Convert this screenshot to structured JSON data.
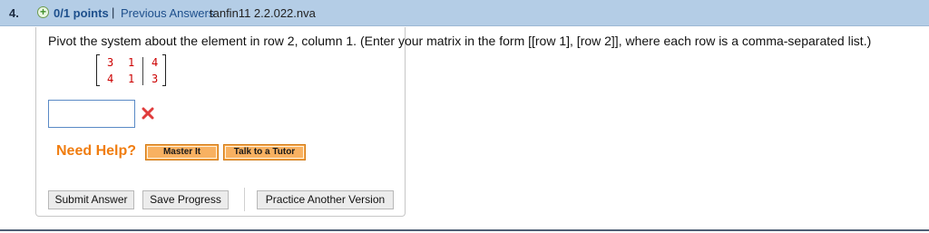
{
  "header": {
    "question_number": "4.",
    "points_icon": "plus-circle-icon",
    "points": "0/1 points",
    "separator": "|",
    "previous_answers": "Previous Answers",
    "source_id": "tanfin11 2.2.022.nva"
  },
  "question": {
    "prompt": "Pivot the system about the element in row 2, column 1. (Enter your matrix in the form [[row 1], [row 2]], where each row is a comma-separated list.)",
    "matrix": {
      "rows": [
        [
          "3",
          "1",
          "4"
        ],
        [
          "4",
          "1",
          "3"
        ]
      ],
      "color": "#cc0000"
    },
    "answer": {
      "value": "",
      "placeholder": ""
    },
    "status_icon": "incorrect-x-icon",
    "status_color": "#e03c3c"
  },
  "help": {
    "title": "Need Help?",
    "master_it": "Master It",
    "talk_to_tutor": "Talk to a Tutor",
    "accent": "#f07d10"
  },
  "actions": {
    "submit": "Submit Answer",
    "save": "Save Progress",
    "practice": "Practice Another Version"
  }
}
